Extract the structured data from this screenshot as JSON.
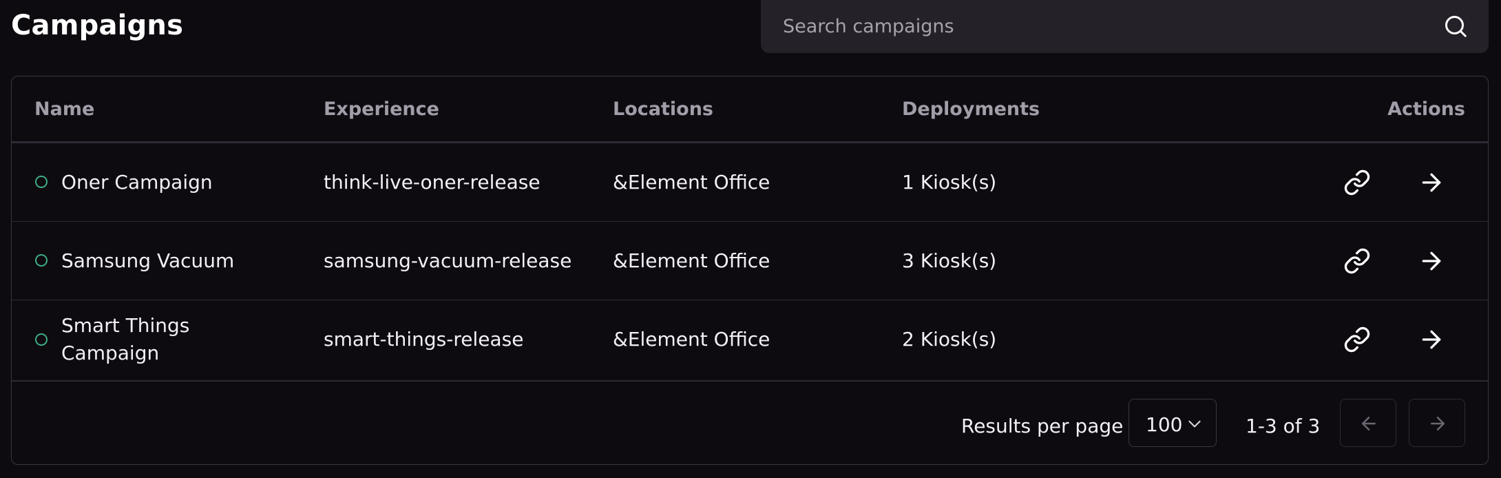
{
  "header": {
    "title": "Campaigns"
  },
  "search": {
    "placeholder": "Search campaigns",
    "value": "",
    "icon": "search-icon"
  },
  "table": {
    "columns": [
      "Name",
      "Experience",
      "Locations",
      "Deployments",
      "Actions"
    ],
    "rows": [
      {
        "status_icon": "status-circle-icon",
        "name": "Oner Campaign",
        "experience": "think-live-oner-release",
        "location": "&Element Office",
        "deployments": "1 Kiosk(s)",
        "actions": [
          "link-icon",
          "arrow-right-icon"
        ]
      },
      {
        "status_icon": "status-circle-icon",
        "name": "Samsung Vacuum",
        "experience": "samsung-vacuum-release",
        "location": "&Element Office",
        "deployments": "3 Kiosk(s)",
        "actions": [
          "link-icon",
          "arrow-right-icon"
        ]
      },
      {
        "status_icon": "status-circle-icon",
        "name": "Smart Things Campaign",
        "experience": "smart-things-release",
        "location": "&Element Office",
        "deployments": "2 Kiosk(s)",
        "actions": [
          "link-icon",
          "arrow-right-icon"
        ]
      }
    ]
  },
  "pagination": {
    "results_per_page_label": "Results per page",
    "results_per_page_value": "100",
    "range_text": "1-3 of 3",
    "prev_icon": "arrow-left-icon",
    "next_icon": "arrow-right-icon"
  },
  "colors": {
    "background": "#0e0b10",
    "search_bg": "#242128",
    "border": "#3a3640",
    "muted_text": "#a29ea9",
    "status": "#3fae86"
  }
}
